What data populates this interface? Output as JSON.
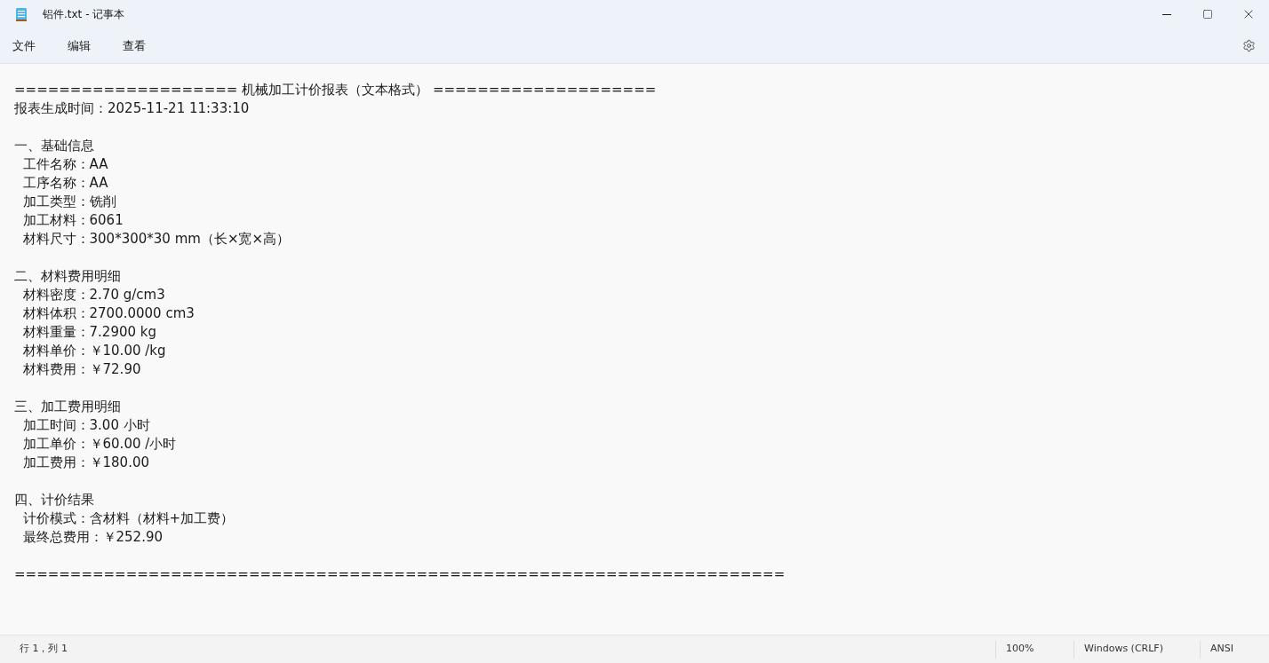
{
  "window": {
    "title": "铝件.txt - 记事本"
  },
  "menu": [
    "文件",
    "编辑",
    "查看"
  ],
  "document": [
    {
      "kind": "line",
      "text": "==================== 机械加工计价报表（文本格式） ===================="
    },
    {
      "kind": "line",
      "text": "报表生成时间：2025-11-21 11:33:10"
    },
    {
      "kind": "blank"
    },
    {
      "kind": "line",
      "text": "一、基础信息"
    },
    {
      "kind": "line",
      "text": "  工件名称：AA"
    },
    {
      "kind": "line",
      "text": "  工序名称：AA"
    },
    {
      "kind": "line",
      "text": "  加工类型：铣削"
    },
    {
      "kind": "line",
      "text": "  加工材料：6061"
    },
    {
      "kind": "line",
      "text": "  材料尺寸：300*300*30 mm（长×宽×高）"
    },
    {
      "kind": "blank"
    },
    {
      "kind": "line",
      "text": "二、材料费用明细"
    },
    {
      "kind": "line",
      "text": "  材料密度：2.70 g/cm3"
    },
    {
      "kind": "line",
      "text": "  材料体积：2700.0000 cm3"
    },
    {
      "kind": "line",
      "text": "  材料重量：7.2900 kg"
    },
    {
      "kind": "line",
      "text": "  材料单价：￥10.00 /kg"
    },
    {
      "kind": "line",
      "text": "  材料费用：￥72.90"
    },
    {
      "kind": "blank"
    },
    {
      "kind": "line",
      "text": "三、加工费用明细"
    },
    {
      "kind": "line",
      "text": "  加工时间：3.00 小时"
    },
    {
      "kind": "line",
      "text": "  加工单价：￥60.00 /小时"
    },
    {
      "kind": "line",
      "text": "  加工费用：￥180.00"
    },
    {
      "kind": "blank"
    },
    {
      "kind": "line",
      "text": "四、计价结果"
    },
    {
      "kind": "line",
      "text": "  计价模式：含材料（材料+加工费）"
    },
    {
      "kind": "line",
      "text": "  最终总费用：￥252.90"
    },
    {
      "kind": "blank"
    },
    {
      "kind": "line",
      "text": "====================================================================="
    }
  ],
  "status_bar": {
    "position": "行 1，列 1",
    "zoom": "100%",
    "line_ending": "Windows (CRLF)",
    "encoding": "ANSI"
  }
}
